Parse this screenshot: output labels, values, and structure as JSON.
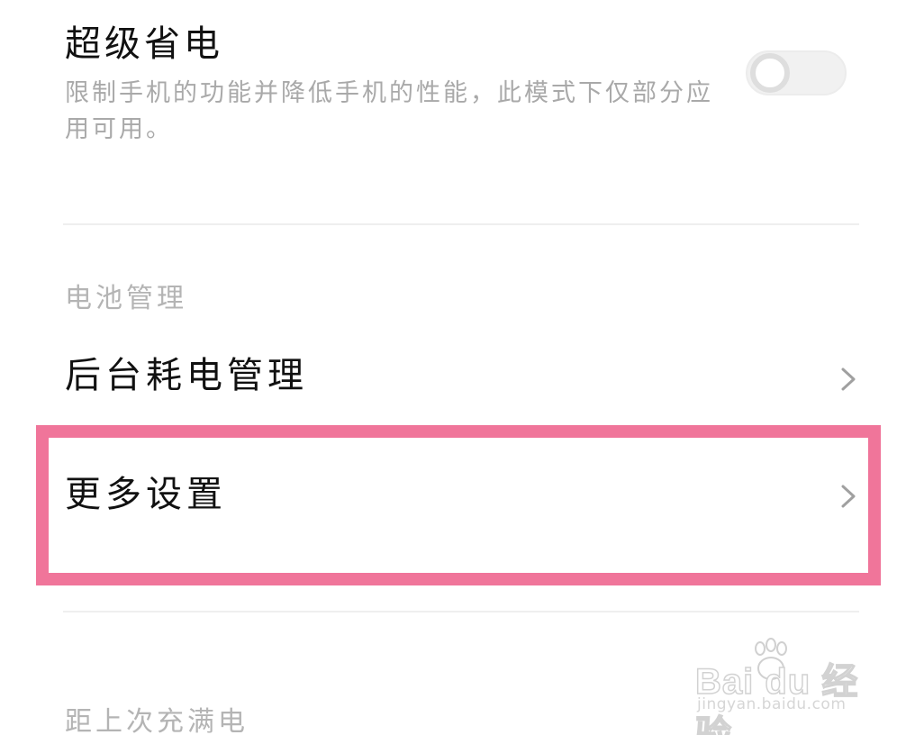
{
  "super_power_saving": {
    "title": "超级省电",
    "description": "限制手机的功能并降低手机的性能，此模式下仅部分应用可用。",
    "enabled": false
  },
  "battery_section": {
    "header": "电池管理",
    "items": [
      {
        "label": "后台耗电管理",
        "icon": "chevron-right-icon"
      },
      {
        "label": "更多设置",
        "icon": "chevron-right-icon",
        "highlighted": true
      }
    ]
  },
  "last_full_charge": {
    "header": "距上次充满电"
  },
  "watermark": {
    "logo_text": "Bai du 经验",
    "url": "jingyan.baidu.com"
  },
  "colors": {
    "highlight": "#f0759a",
    "secondary_text": "#a9a9a9",
    "primary_text": "#111111"
  }
}
